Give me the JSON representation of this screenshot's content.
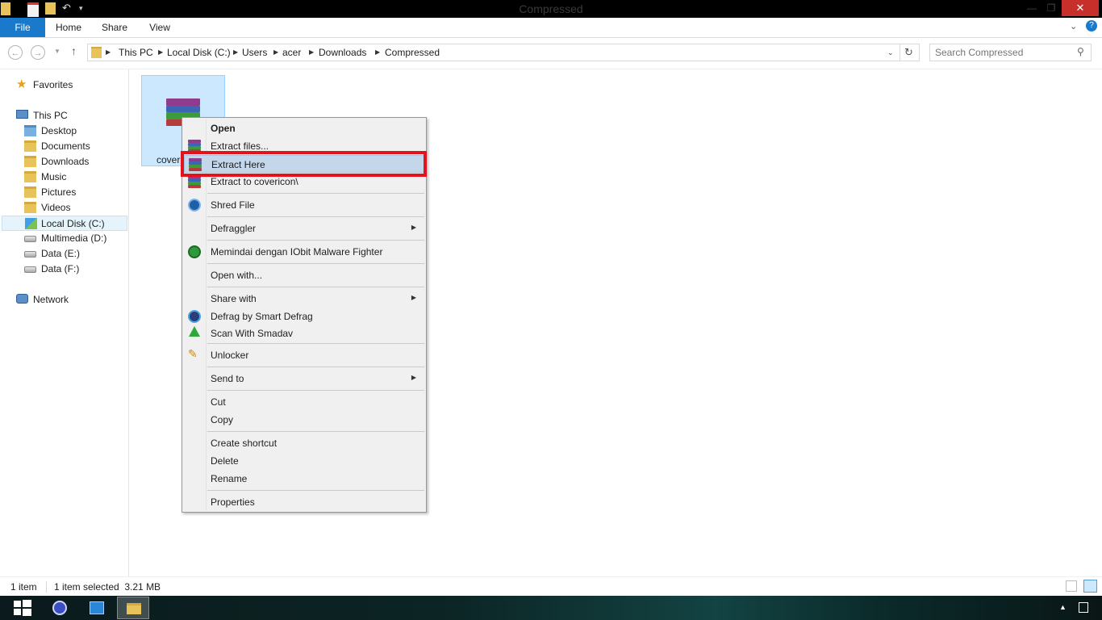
{
  "window": {
    "title": "Compressed",
    "close_glyph": "✕",
    "minimize_glyph": "—",
    "maximize_glyph": "❐"
  },
  "ribbon": {
    "tabs": [
      {
        "label": "File"
      },
      {
        "label": "Home"
      },
      {
        "label": "Share"
      },
      {
        "label": "View"
      }
    ]
  },
  "address": {
    "crumbs": [
      "This PC",
      "Local Disk (C:)",
      "Users",
      "acer",
      "Downloads",
      "Compressed"
    ],
    "search_placeholder": "Search Compressed"
  },
  "nav": {
    "favorites": "Favorites",
    "this_pc": "This PC",
    "folders": [
      "Desktop",
      "Documents",
      "Downloads",
      "Music",
      "Pictures",
      "Videos"
    ],
    "drives": [
      "Local Disk (C:)",
      "Multimedia (D:)",
      "Data (E:)",
      "Data (F:)"
    ],
    "network": "Network"
  },
  "file": {
    "label": "coveri"
  },
  "context_menu": {
    "items": [
      {
        "label": "Open"
      },
      {
        "label": "Extract files..."
      },
      {
        "label": "Extract Here"
      },
      {
        "label": "Extract to covericon\\"
      },
      {
        "label": "Shred File"
      },
      {
        "label": "Defraggler"
      },
      {
        "label": "Memindai dengan IObit Malware Fighter"
      },
      {
        "label": "Open with..."
      },
      {
        "label": "Share with"
      },
      {
        "label": "Defrag by Smart Defrag"
      },
      {
        "label": "Scan With Smadav"
      },
      {
        "label": "Unlocker"
      },
      {
        "label": "Send to"
      },
      {
        "label": "Cut"
      },
      {
        "label": "Copy"
      },
      {
        "label": "Create shortcut"
      },
      {
        "label": "Delete"
      },
      {
        "label": "Rename"
      },
      {
        "label": "Properties"
      }
    ]
  },
  "status": {
    "count": "1 item",
    "selection": "1 item selected  3.21 MB"
  },
  "colors": {
    "file_tab": "#1979ca",
    "close_button": "#c7302a",
    "highlight_box": "#e3131e",
    "selection": "#cce8ff"
  }
}
